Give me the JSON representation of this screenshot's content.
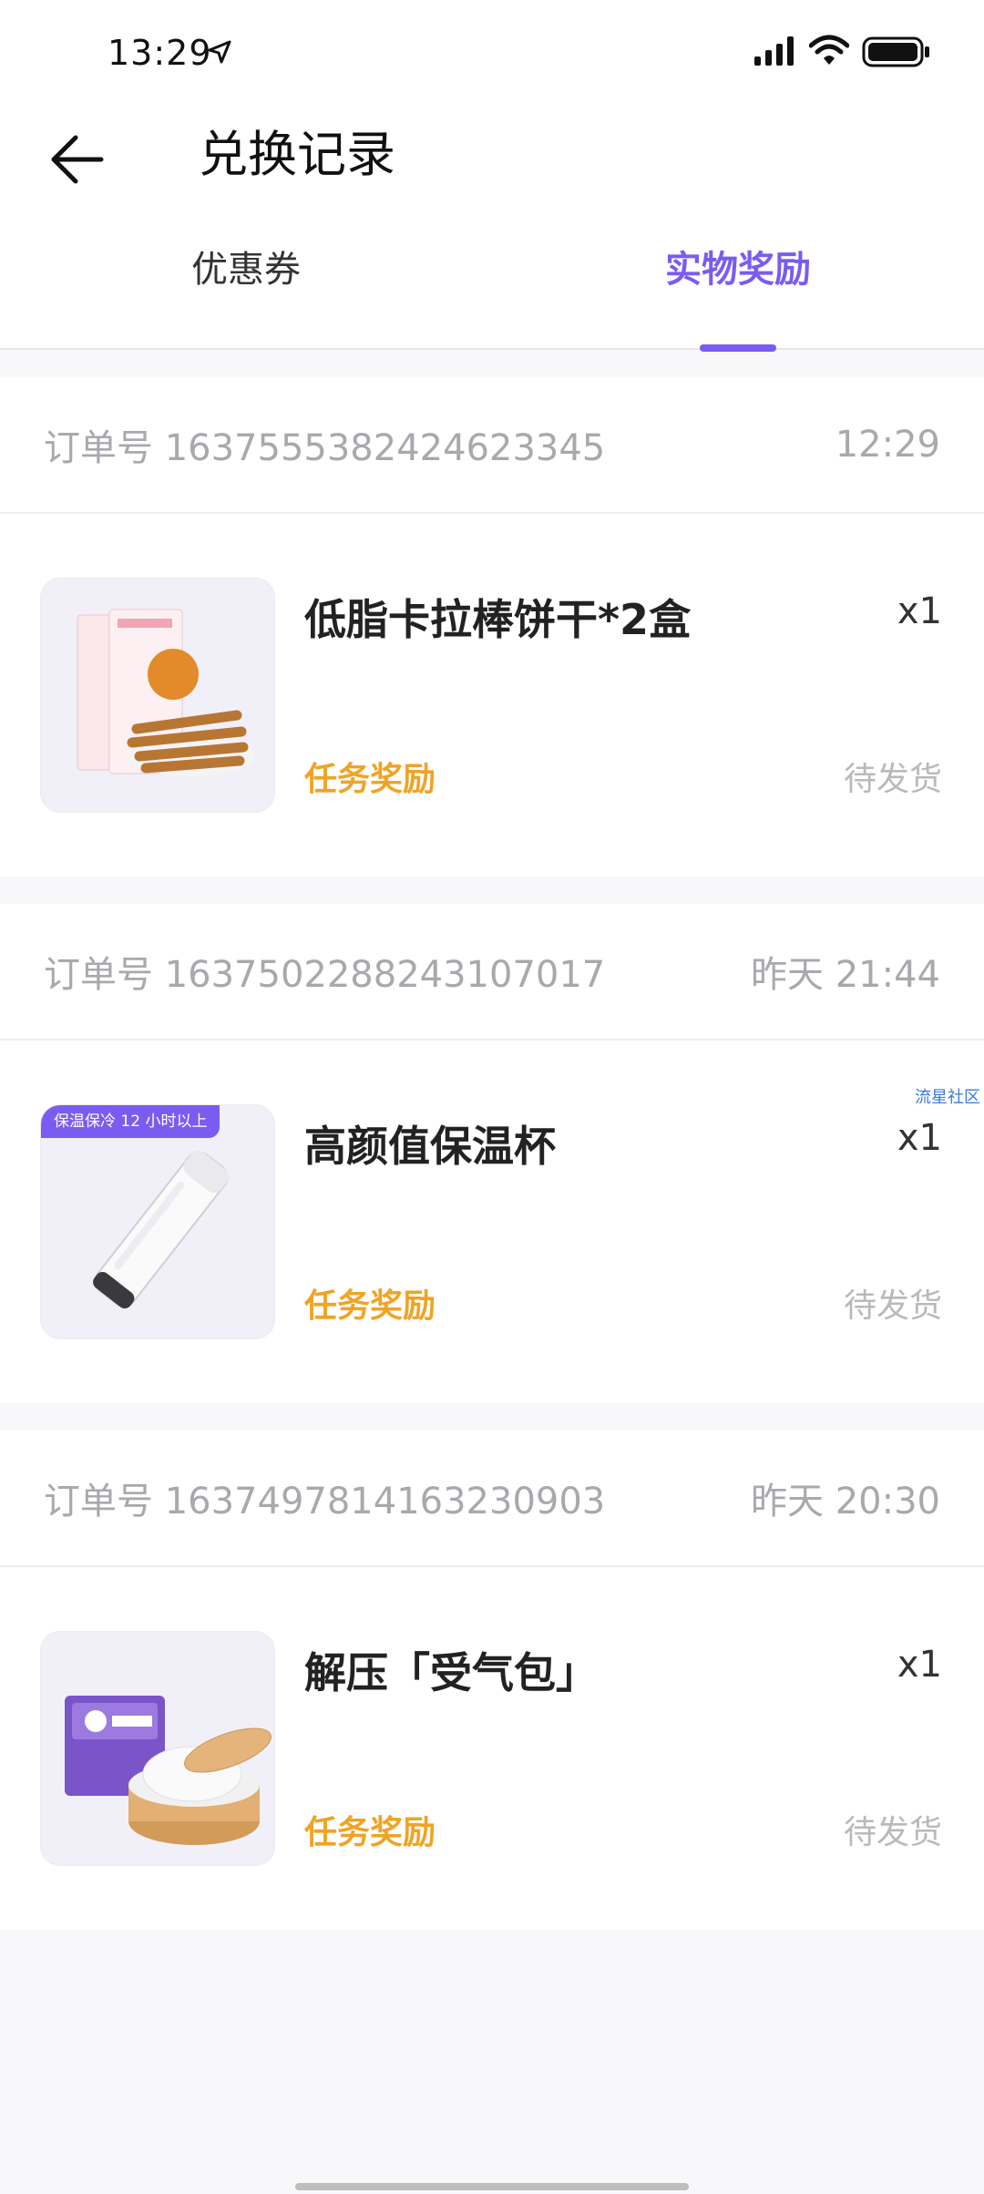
{
  "status_bar": {
    "time": "13:29",
    "icons": [
      "location-arrow-icon",
      "signal-icon",
      "wifi-icon",
      "battery-icon"
    ]
  },
  "header": {
    "title": "兑换记录",
    "back_icon": "arrow-left-icon"
  },
  "tabs": [
    {
      "label": "优惠券",
      "active": false
    },
    {
      "label": "实物奖励",
      "active": true
    }
  ],
  "colors": {
    "accent": "#7b5cf0",
    "reward_tag": "#f0a324",
    "muted": "#a8a8ad"
  },
  "orders": [
    {
      "order_no": "订单号 1637555382424623345",
      "time": "12:29",
      "item_name": "低脂卡拉棒饼干*2盒",
      "qty": "x1",
      "tag": "任务奖励",
      "status": "待发货",
      "badge": ""
    },
    {
      "order_no": "订单号 1637502288243107017",
      "time": "昨天 21:44",
      "item_name": "高颜值保温杯",
      "qty": "x1",
      "tag": "任务奖励",
      "status": "待发货",
      "badge": "保温保冷 12 小时以上",
      "watermark": "流星社区"
    },
    {
      "order_no": "订单号 1637497814163230903",
      "time": "昨天 20:30",
      "item_name": "解压「受气包」",
      "qty": "x1",
      "tag": "任务奖励",
      "status": "待发货",
      "badge": ""
    }
  ]
}
